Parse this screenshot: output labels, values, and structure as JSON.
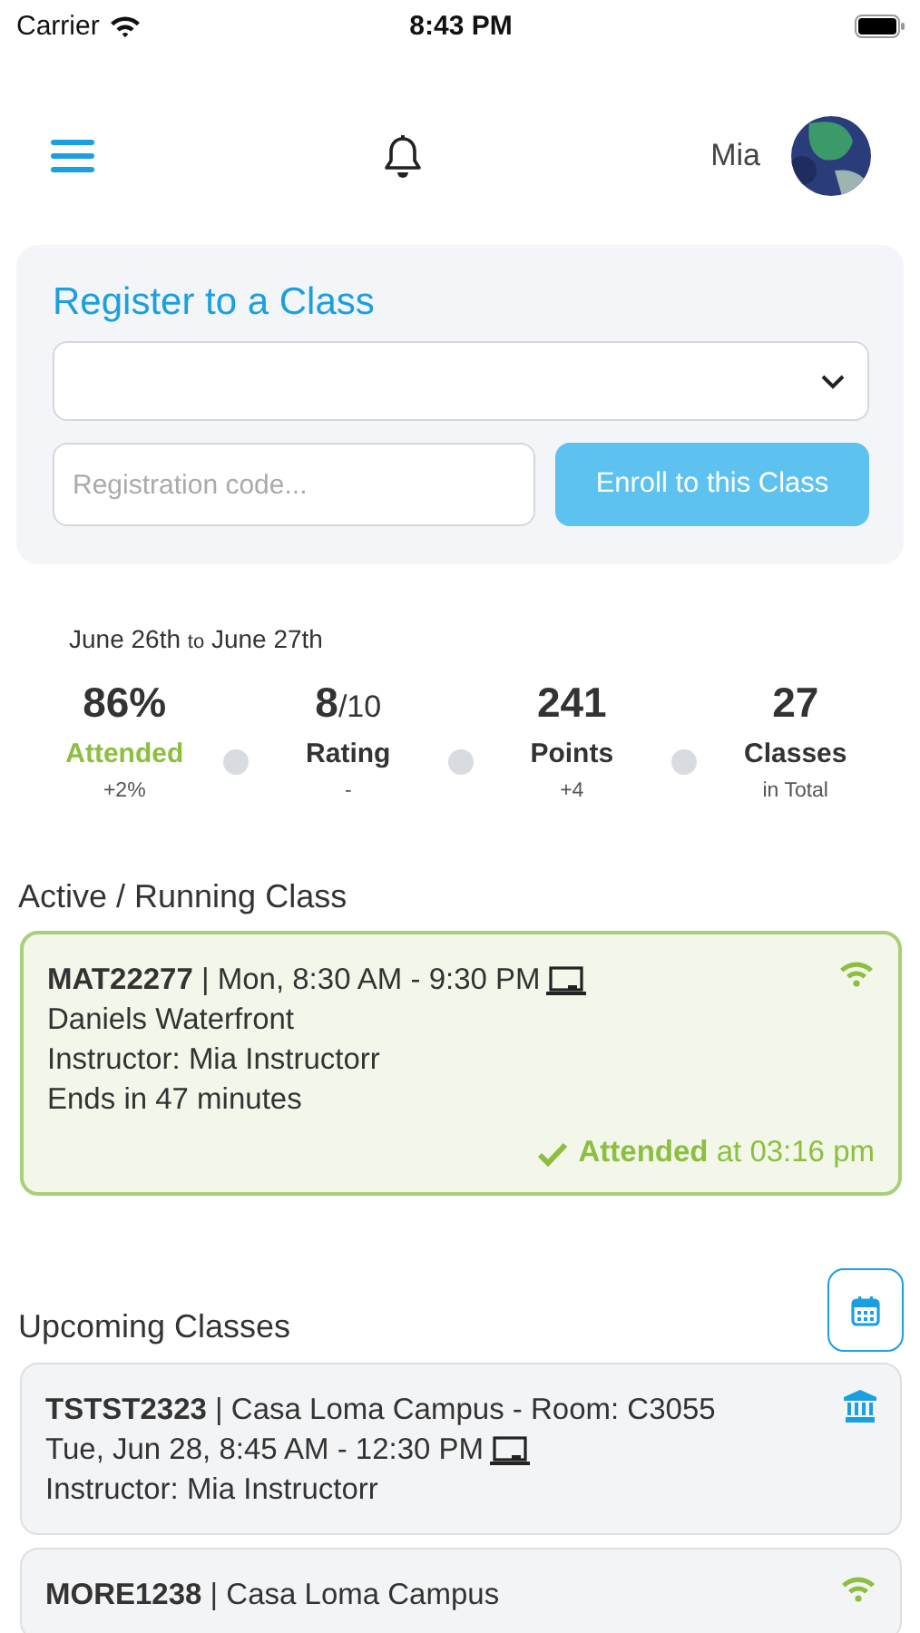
{
  "status_bar": {
    "carrier": "Carrier",
    "time": "8:43 PM"
  },
  "header": {
    "user_name": "Mia"
  },
  "register": {
    "title": "Register to a Class",
    "code_placeholder": "Registration code...",
    "enroll_button": "Enroll to this Class",
    "enroll_disabled": true
  },
  "period": {
    "from": "June 26th",
    "separator": "to",
    "to": "June 27th"
  },
  "stats": [
    {
      "value": "86%",
      "label": "Attended",
      "highlight": true,
      "note": "+2%"
    },
    {
      "value": "8",
      "suffix": "/10",
      "label": "Rating",
      "highlight": false,
      "note": "-"
    },
    {
      "value": "241",
      "label": "Points",
      "highlight": false,
      "note": "+4"
    },
    {
      "value": "27",
      "label": "Classes",
      "highlight": false,
      "note": "in Total"
    }
  ],
  "active": {
    "title": "Active / Running Class",
    "card": {
      "kind": "online",
      "lines": [
        {
          "text": "**MAT22277** | Mon, 8:30 AM - 9:30 PM",
          "laptop": true
        },
        {
          "text": "Daniels Waterfront",
          "laptop": false
        },
        {
          "text": "Instructor: Mia Instructorr",
          "laptop": false
        },
        {
          "text": "Ends in 47 minutes",
          "laptop": false
        }
      ],
      "attended": true,
      "attended_label": "Attended",
      "attended_time": "at 03:16 pm"
    }
  },
  "upcoming": {
    "title": "Upcoming Classes",
    "cards": [
      {
        "kind": "campus",
        "lines": [
          {
            "text": "**TSTST2323** | Casa Loma Campus - Room: C3055",
            "laptop": false
          },
          {
            "text": "Tue, Jun 28, 8:45 AM - 12:30 PM",
            "laptop": true
          },
          {
            "text": "Instructor: Mia Instructorr",
            "laptop": false
          }
        ]
      },
      {
        "kind": "online",
        "lines": [
          {
            "text": "**MORE1238** | Casa Loma Campus",
            "laptop": false
          }
        ]
      }
    ]
  }
}
